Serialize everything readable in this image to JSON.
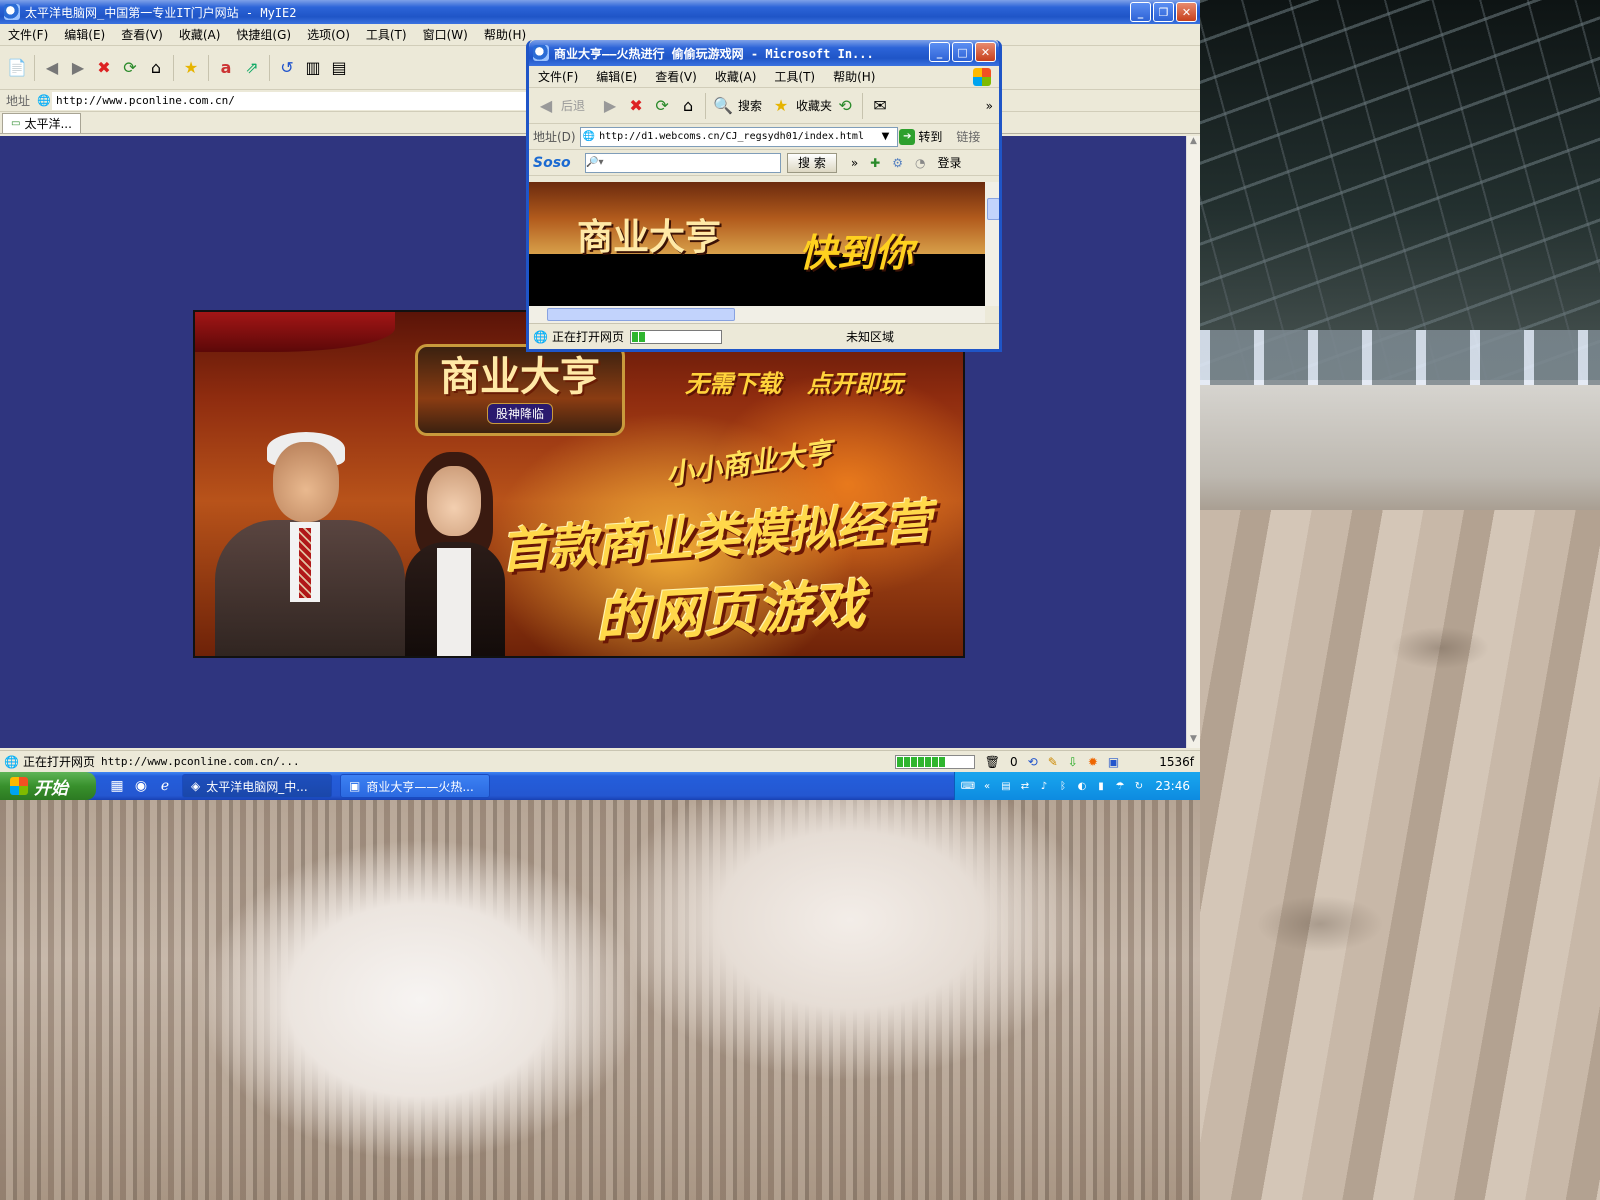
{
  "main_window": {
    "title": "太平洋电脑网_中国第一专业IT门户网站 - MyIE2",
    "menu": [
      "文件(F)",
      "编辑(E)",
      "查看(V)",
      "收藏(A)",
      "快捷组(G)",
      "选项(O)",
      "工具(T)",
      "窗口(W)",
      "帮助(H)"
    ],
    "address_label": "地址",
    "address_url": "http://www.pconline.com.cn/",
    "tab_label": "太平洋...",
    "status_text": "正在打开网页",
    "status_url": "http://www.pconline.com.cn/...",
    "popup_blocked_count": "0",
    "resolution": "1536f"
  },
  "banner": {
    "logo_text": "商业大亨",
    "logo_subtitle": "股神降临",
    "tagline_1": "无需下载",
    "tagline_2": "点开即玩",
    "small_title": "小小商业大亨",
    "headline_1": "首款商业类模拟经营",
    "headline_2": "的网页游戏"
  },
  "popup_window": {
    "title": "商业大亨——火热进行 偷偷玩游戏网 - Microsoft In...",
    "menu": [
      "文件(F)",
      "编辑(E)",
      "查看(V)",
      "收藏(A)",
      "工具(T)",
      "帮助(H)"
    ],
    "back_label": "后退",
    "search_label": "搜索",
    "favorites_label": "收藏夹",
    "address_label": "地址(D)",
    "address_url": "http://d1.webcoms.cn/CJ_regsydh01/index.html",
    "go_label": "转到",
    "links_label": "链接",
    "soso_logo": "Soso",
    "search_button": "搜 索",
    "login_label": "登录",
    "content_title": "商业大亨",
    "content_overlay": "快到你",
    "status_text": "正在打开网页",
    "zone_text": "未知区域"
  },
  "taskbar": {
    "start_label": "开始",
    "task_1": "太平洋电脑网_中...",
    "task_2": "商业大亨——火热...",
    "clock": "23:46"
  },
  "colors": {
    "xp_blue": "#245edb",
    "page_background": "#2f357f",
    "start_green": "#38902c",
    "progress_green": "#2fb52f"
  }
}
